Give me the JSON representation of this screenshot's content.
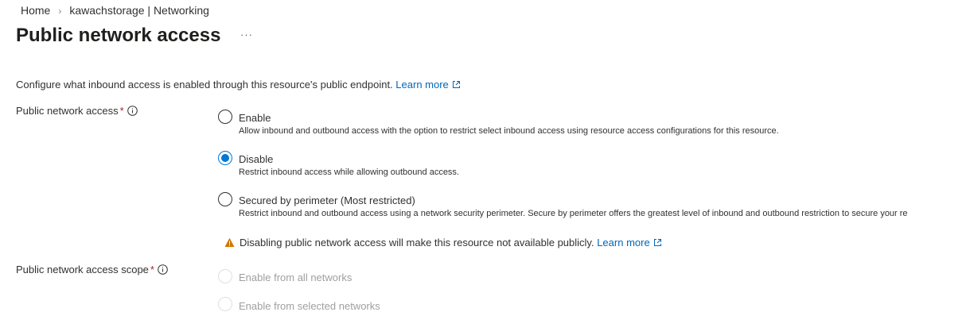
{
  "breadcrumb": {
    "home": "Home",
    "separator": "›",
    "current": "kawachstorage | Networking"
  },
  "page": {
    "title": "Public network access",
    "more": "···"
  },
  "description": {
    "text": "Configure what inbound access is enabled through this resource's public endpoint.",
    "learn_more": "Learn more"
  },
  "public_network_access": {
    "label": "Public network access",
    "required_marker": "*",
    "info_icon": "info-icon",
    "options": [
      {
        "label": "Enable",
        "description": "Allow inbound and outbound access with the option to restrict select inbound access using resource access configurations for this resource.",
        "selected": false
      },
      {
        "label": "Disable",
        "description": "Restrict inbound access while allowing outbound access.",
        "selected": true
      },
      {
        "label": "Secured by perimeter (Most restricted)",
        "description": "Restrict inbound and outbound access using a network security perimeter. Secure by perimeter offers the greatest level of inbound and outbound restriction to secure your re",
        "selected": false
      }
    ]
  },
  "warning": {
    "icon": "warning-icon",
    "text": "Disabling public network access will make this resource not available publicly.",
    "learn_more": "Learn more"
  },
  "scope": {
    "label": "Public network access scope",
    "required_marker": "*",
    "info_icon": "info-icon",
    "options": [
      {
        "label": "Enable from all networks",
        "disabled": true
      },
      {
        "label": "Enable from selected networks",
        "disabled": true
      }
    ]
  },
  "colors": {
    "link": "#0067b8",
    "radio_selected": "#0078d4",
    "required": "#a4262c",
    "warning": "#d47500",
    "disabled_text": "#a19f9d"
  }
}
